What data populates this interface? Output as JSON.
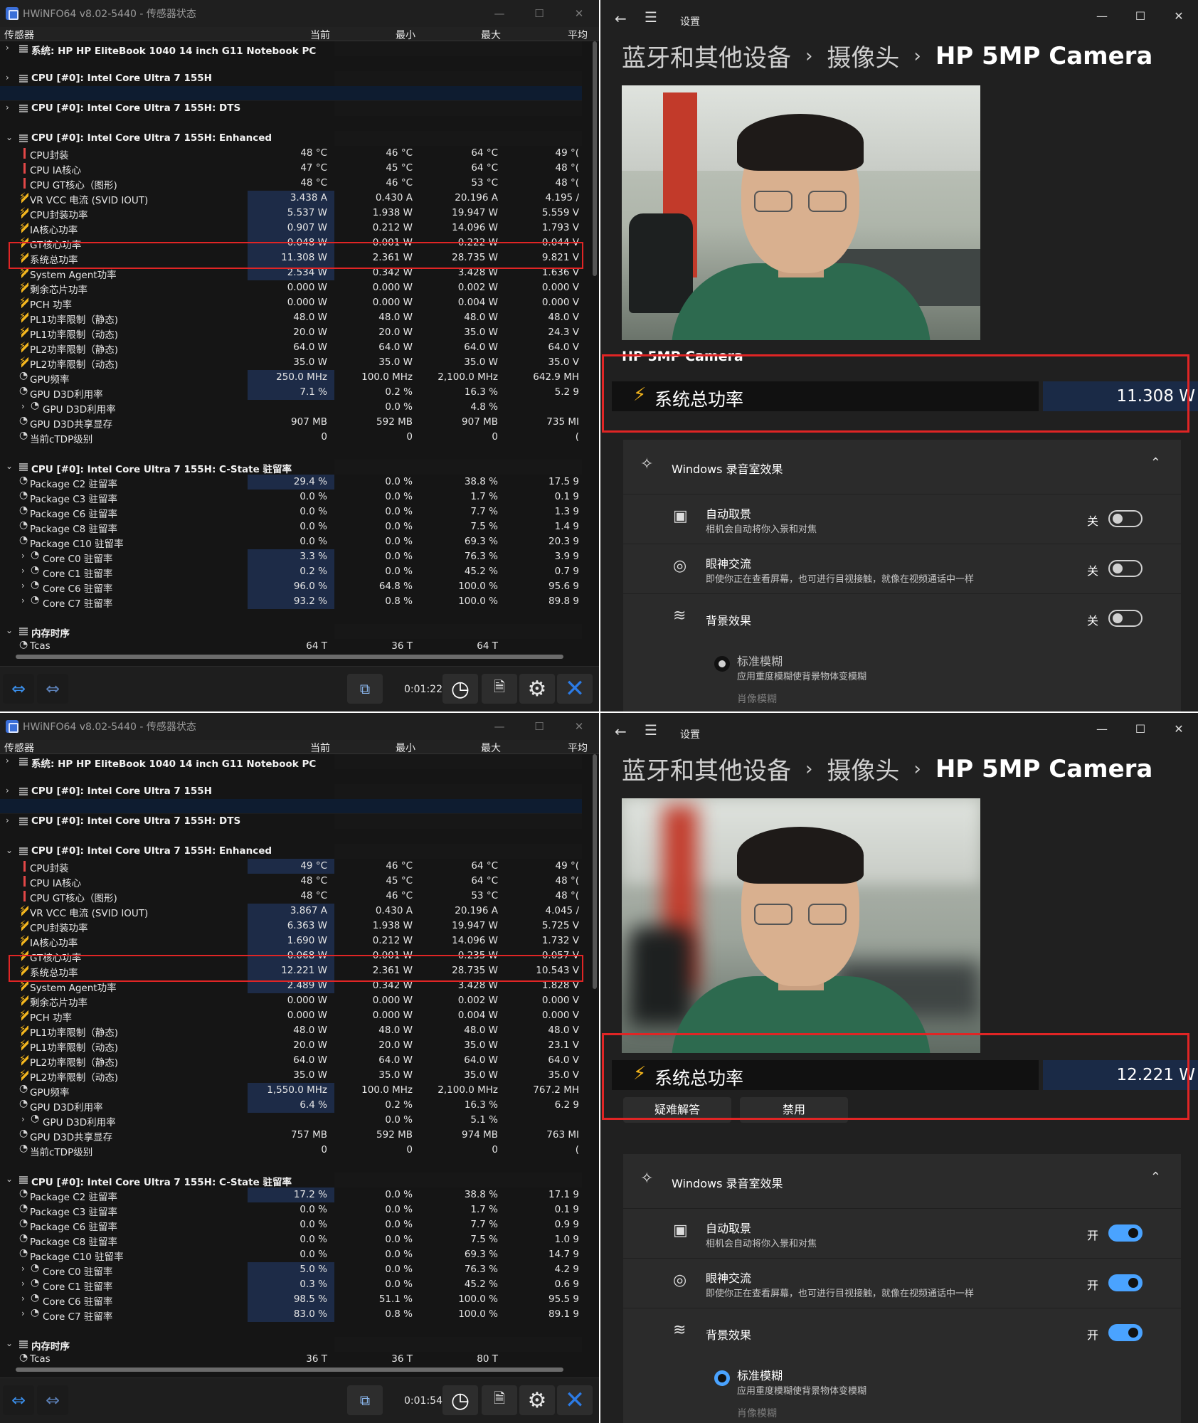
{
  "hwinfo": {
    "title": "HWiNFO64 v8.02-5440 - 传感器状态",
    "columns": {
      "sensor": "传感器",
      "cur": "当前",
      "min": "最小",
      "max": "最大",
      "avg": "平均"
    },
    "group_system": "系统: HP HP EliteBook 1040 14 inch G11 Notebook PC",
    "group_cpu": "CPU [#0]: Intel Core Ultra 7 155H",
    "group_dts": "CPU [#0]: Intel Core Ultra 7 155H: DTS",
    "group_enh": "CPU [#0]: Intel Core Ultra 7 155H: Enhanced",
    "group_cstate": "CPU [#0]: Intel Core Ultra 7 155H: C-State 驻留率",
    "group_mem": "内存时序",
    "labels": {
      "cpu_pkg": "CPU封装",
      "ia_core": "CPU IA核心",
      "gt_core": "CPU GT核心（图形)",
      "vr_vcc": "VR VCC 电流 (SVID IOUT)",
      "pkg_pwr": "CPU封装功率",
      "ia_pwr": "IA核心功率",
      "gt_pwr": "GT核心功率",
      "sys_pwr": "系统总功率",
      "sa_pwr": "System Agent功率",
      "rest_pwr": "剩余芯片功率",
      "pch_pwr": "PCH 功率",
      "pl1s": "PL1功率限制（静态)",
      "pl1d": "PL1功率限制（动态)",
      "pl2s": "PL2功率限制（静态)",
      "pl2d": "PL2功率限制（动态)",
      "gpu_freq": "GPU频率",
      "gpu_d3d": "GPU D3D利用率",
      "gpu_d3d2": "GPU D3D利用率",
      "gpu_mem": "GPU D3D共享显存",
      "ctdp": "当前cTDP级别",
      "c2": "Package C2 驻留率",
      "c3": "Package C3 驻留率",
      "c6": "Package C6 驻留率",
      "c8": "Package C8 驻留率",
      "c10": "Package C10 驻留率",
      "core_c0": "Core C0 驻留率",
      "core_c1": "Core C1 驻留率",
      "core_c6": "Core C6 驻留率",
      "core_c7": "Core C7 驻留率",
      "tcas": "Tcas"
    }
  },
  "top": {
    "timer": "0:01:22",
    "values": {
      "cpu_pkg": [
        "48 °C",
        "46 °C",
        "64 °C",
        "49 °("
      ],
      "ia_core": [
        "47 °C",
        "45 °C",
        "64 °C",
        "48 °("
      ],
      "gt_core": [
        "48 °C",
        "46 °C",
        "53 °C",
        "48 °("
      ],
      "vr_vcc": [
        "3.438 A",
        "0.430 A",
        "20.196 A",
        "4.195 /"
      ],
      "pkg_pwr": [
        "5.537 W",
        "1.938 W",
        "19.947 W",
        "5.559 V"
      ],
      "ia_pwr": [
        "0.907 W",
        "0.212 W",
        "14.096 W",
        "1.793 V"
      ],
      "gt_pwr": [
        "0.048 W",
        "0.001 W",
        "0.222 W",
        "0.044 V"
      ],
      "sys_pwr": [
        "11.308 W",
        "2.361 W",
        "28.735 W",
        "9.821 V"
      ],
      "sa_pwr": [
        "2.534 W",
        "0.342 W",
        "3.428 W",
        "1.636 V"
      ],
      "rest_pwr": [
        "0.000 W",
        "0.000 W",
        "0.002 W",
        "0.000 V"
      ],
      "pch_pwr": [
        "0.000 W",
        "0.000 W",
        "0.004 W",
        "0.000 V"
      ],
      "pl1s": [
        "48.0 W",
        "48.0 W",
        "48.0 W",
        "48.0 V"
      ],
      "pl1d": [
        "20.0 W",
        "20.0 W",
        "35.0 W",
        "24.3 V"
      ],
      "pl2s": [
        "64.0 W",
        "64.0 W",
        "64.0 W",
        "64.0 V"
      ],
      "pl2d": [
        "35.0 W",
        "35.0 W",
        "35.0 W",
        "35.0 V"
      ],
      "gpu_freq": [
        "250.0 MHz",
        "100.0 MHz",
        "2,100.0 MHz",
        "642.9 MH"
      ],
      "gpu_d3d": [
        "7.1 %",
        "0.2 %",
        "16.3 %",
        "5.2 9"
      ],
      "gpu_d3d2": [
        "",
        "0.0 %",
        "4.8 %",
        ""
      ],
      "gpu_mem": [
        "907 MB",
        "592 MB",
        "907 MB",
        "735 MI"
      ],
      "ctdp": [
        "0",
        "0",
        "0",
        "("
      ],
      "c2": [
        "29.4 %",
        "0.0 %",
        "38.8 %",
        "17.5 9"
      ],
      "c3": [
        "0.0 %",
        "0.0 %",
        "1.7 %",
        "0.1 9"
      ],
      "c6": [
        "0.0 %",
        "0.0 %",
        "7.7 %",
        "1.3 9"
      ],
      "c8": [
        "0.0 %",
        "0.0 %",
        "7.5 %",
        "1.4 9"
      ],
      "c10": [
        "0.0 %",
        "0.0 %",
        "69.3 %",
        "20.3 9"
      ],
      "core_c0": [
        "3.3 %",
        "0.0 %",
        "76.3 %",
        "3.9 9"
      ],
      "core_c1": [
        "0.2 %",
        "0.0 %",
        "45.2 %",
        "0.7 9"
      ],
      "core_c6": [
        "96.0 %",
        "64.8 %",
        "100.0 %",
        "95.6 9"
      ],
      "core_c7": [
        "93.2 %",
        "0.8 %",
        "100.0 %",
        "89.8 9"
      ],
      "tcas": [
        "64 T",
        "36 T",
        "64 T",
        ""
      ]
    }
  },
  "bottom": {
    "timer": "0:01:54",
    "values": {
      "cpu_pkg": [
        "49 °C",
        "46 °C",
        "64 °C",
        "49 °("
      ],
      "ia_core": [
        "48 °C",
        "45 °C",
        "64 °C",
        "48 °("
      ],
      "gt_core": [
        "48 °C",
        "46 °C",
        "53 °C",
        "48 °("
      ],
      "vr_vcc": [
        "3.867 A",
        "0.430 A",
        "20.196 A",
        "4.045 /"
      ],
      "pkg_pwr": [
        "6.363 W",
        "1.938 W",
        "19.947 W",
        "5.725 V"
      ],
      "ia_pwr": [
        "1.690 W",
        "0.212 W",
        "14.096 W",
        "1.732 V"
      ],
      "gt_pwr": [
        "0.068 W",
        "0.001 W",
        "0.235 W",
        "0.057 V"
      ],
      "sys_pwr": [
        "12.221 W",
        "2.361 W",
        "28.735 W",
        "10.543 V"
      ],
      "sa_pwr": [
        "2.489 W",
        "0.342 W",
        "3.428 W",
        "1.828 V"
      ],
      "rest_pwr": [
        "0.000 W",
        "0.000 W",
        "0.002 W",
        "0.000 V"
      ],
      "pch_pwr": [
        "0.000 W",
        "0.000 W",
        "0.004 W",
        "0.000 V"
      ],
      "pl1s": [
        "48.0 W",
        "48.0 W",
        "48.0 W",
        "48.0 V"
      ],
      "pl1d": [
        "20.0 W",
        "20.0 W",
        "35.0 W",
        "23.1 V"
      ],
      "pl2s": [
        "64.0 W",
        "64.0 W",
        "64.0 W",
        "64.0 V"
      ],
      "pl2d": [
        "35.0 W",
        "35.0 W",
        "35.0 W",
        "35.0 V"
      ],
      "gpu_freq": [
        "1,550.0 MHz",
        "100.0 MHz",
        "2,100.0 MHz",
        "767.2 MH"
      ],
      "gpu_d3d": [
        "6.4 %",
        "0.2 %",
        "16.3 %",
        "6.2 9"
      ],
      "gpu_d3d2": [
        "",
        "0.0 %",
        "5.1 %",
        ""
      ],
      "gpu_mem": [
        "757 MB",
        "592 MB",
        "974 MB",
        "763 MI"
      ],
      "ctdp": [
        "0",
        "0",
        "0",
        "("
      ],
      "c2": [
        "17.2 %",
        "0.0 %",
        "38.8 %",
        "17.1 9"
      ],
      "c3": [
        "0.0 %",
        "0.0 %",
        "1.7 %",
        "0.1 9"
      ],
      "c6": [
        "0.0 %",
        "0.0 %",
        "7.7 %",
        "0.9 9"
      ],
      "c8": [
        "0.0 %",
        "0.0 %",
        "7.5 %",
        "1.0 9"
      ],
      "c10": [
        "0.0 %",
        "0.0 %",
        "69.3 %",
        "14.7 9"
      ],
      "core_c0": [
        "5.0 %",
        "0.0 %",
        "76.3 %",
        "4.2 9"
      ],
      "core_c1": [
        "0.3 %",
        "0.0 %",
        "45.2 %",
        "0.6 9"
      ],
      "core_c6": [
        "98.5 %",
        "51.1 %",
        "100.0 %",
        "95.5 9"
      ],
      "core_c7": [
        "83.0 %",
        "0.8 %",
        "100.0 %",
        "89.1 9"
      ],
      "tcas": [
        "36 T",
        "36 T",
        "80 T",
        ""
      ]
    }
  },
  "settings": {
    "title": "设置",
    "crumb1": "蓝牙和其他设备",
    "crumb2": "摄像头",
    "crumb3": "HP 5MP Camera",
    "sep": "›",
    "camera_name": "HP 5MP Camera",
    "power_label": "系统总功率",
    "top_power": "11.308 W",
    "bottom_power": "12.221 W",
    "troubleshoot": "疑难解答",
    "disable": "禁用",
    "studio_title": "Windows 录音室效果",
    "auto_frame": "自动取景",
    "auto_frame_desc": "相机会自动将你入景和对焦",
    "eye_contact": "眼神交流",
    "eye_contact_desc": "即使你正在查看屏幕，也可进行目视接触，就像在视频通话中一样",
    "bg_effects": "背景效果",
    "standard_blur": "标准模糊",
    "standard_blur_desc": "应用重度模糊使背景物体变模糊",
    "portrait_blur": "肖像模糊",
    "off": "关",
    "on": "开"
  },
  "colors": {
    "accent": "#4aa3ff",
    "highlight": "#e02525",
    "cur_bg": "#1d2b47"
  }
}
